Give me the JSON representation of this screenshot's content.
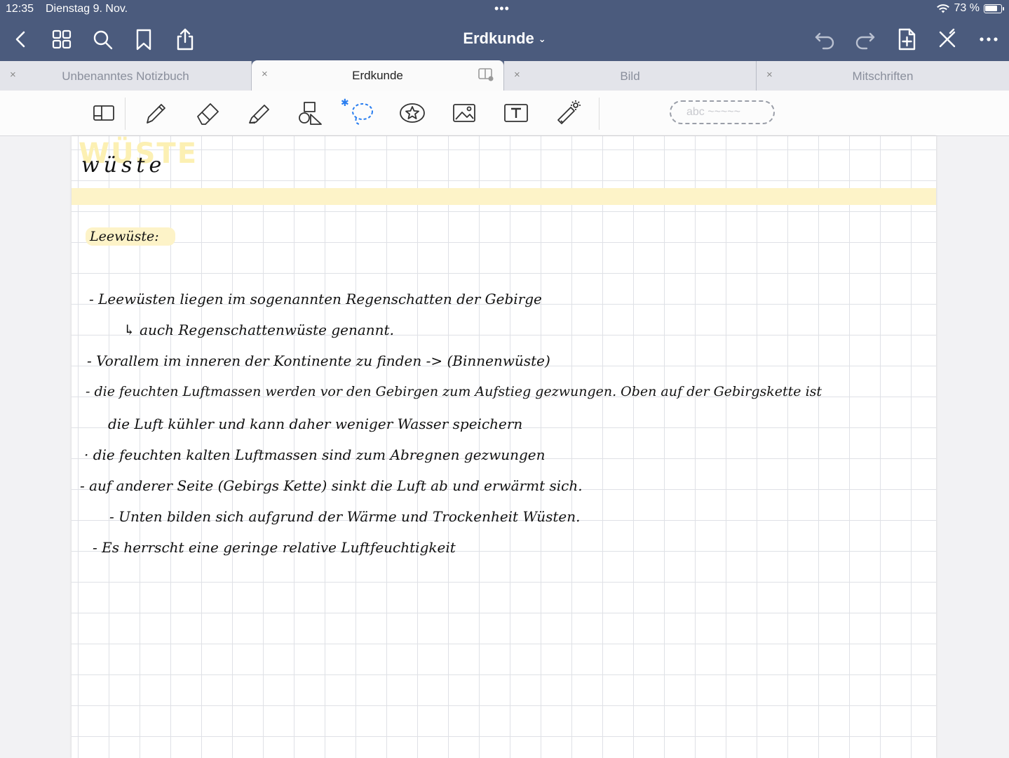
{
  "status": {
    "time": "12:35",
    "date": "Dienstag 9. Nov.",
    "battery": "73 %",
    "dots": "•••"
  },
  "nav": {
    "title": "Erdkunde",
    "title_chevron": "⌄",
    "left_icons": [
      "back-icon",
      "grid-icon",
      "search-icon",
      "bookmark-icon",
      "share-icon"
    ],
    "right_icons": [
      "undo-icon",
      "redo-icon",
      "add-page-icon",
      "close-pen-icon",
      "more-icon"
    ]
  },
  "tabs": [
    {
      "label": "Unbenanntes Notizbuch",
      "active": false
    },
    {
      "label": "Erdkunde",
      "active": true
    },
    {
      "label": "Bild",
      "active": false
    },
    {
      "label": "Mitschriften",
      "active": false
    }
  ],
  "tab_close": "×",
  "toolbar": {
    "tools": [
      "zoom-box-icon",
      "pen-icon",
      "eraser-icon",
      "highlighter-icon",
      "shapes-icon",
      "lasso-icon",
      "sticker-icon",
      "image-icon",
      "text-icon",
      "laser-pointer-icon"
    ],
    "bluetooth": "✱",
    "pill_text": "abc ~~~~~"
  },
  "notes": {
    "title_shadow": "WÜSTE",
    "title": "wüste",
    "subheading": "Leewüste:",
    "lines": [
      "- Leewüsten liegen im sogenannten Regenschatten der Gebirge",
      "↳ auch Regenschattenwüste genannt.",
      "- Vorallem im inneren der Kontinente zu finden -> (Binnenwüste)",
      "- die feuchten Luftmassen werden vor den Gebirgen zum Aufstieg gezwungen. Oben auf der Gebirgskette ist",
      "die Luft kühler und kann daher weniger Wasser speichern",
      "· die feuchten kalten Luftmassen sind zum Abregnen gezwungen",
      "- auf anderer Seite (Gebirgs Kette) sinkt die Luft ab und erwärmt sich.",
      "- Unten bilden sich aufgrund der Wärme und Trockenheit Wüsten.",
      "- Es herrscht eine geringe relative Luftfeuchtigkeit"
    ]
  }
}
